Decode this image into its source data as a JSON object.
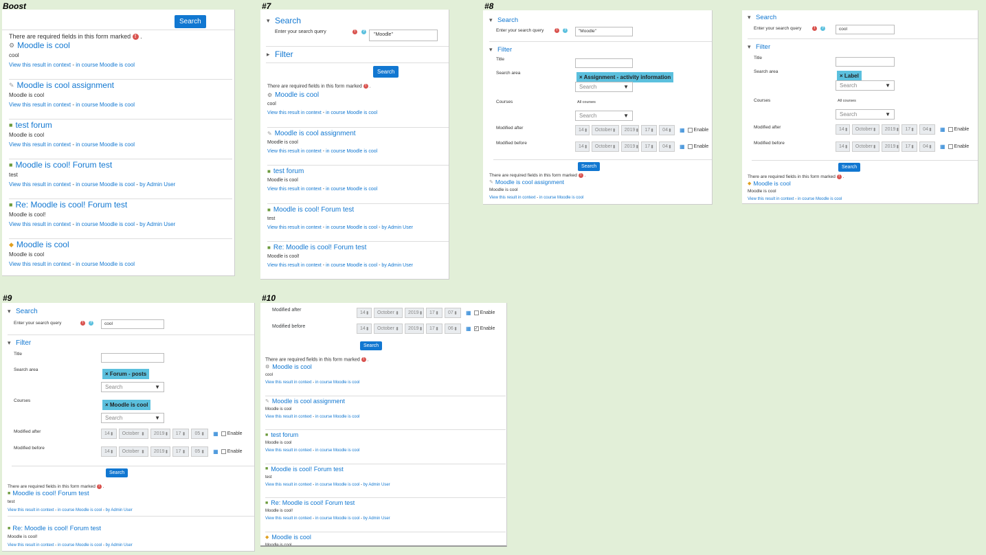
{
  "labels": {
    "boost": "Boost",
    "p7": "#7",
    "p8": "#8",
    "p9": "#9",
    "p10": "#10"
  },
  "common": {
    "search_header": "Search",
    "filter_header": "Filter",
    "query_label": "Enter your search query",
    "search_button": "Search",
    "required_note": "There are required fields in this form marked",
    "title_label": "Title",
    "area_label": "Search area",
    "courses_label": "Courses",
    "mod_after": "Modified after",
    "mod_before": "Modified before",
    "all_courses": "All courses",
    "select_placeholder": "Search",
    "enable": "Enable",
    "view_link": "View this result in context",
    "sep": " - ",
    "in_course": "in course Moodle is cool",
    "by_admin": "by Admin User",
    "date": {
      "day": "14",
      "month": "October",
      "year": "2019",
      "hour": "17"
    }
  },
  "icons": {
    "course": "course-icon",
    "assign": "assignment-icon",
    "forum": "forum-icon",
    "label": "label-icon",
    "required": "required-icon",
    "help": "help-icon",
    "calendar": "calendar-icon"
  },
  "p7": {
    "query": "\"Moodle\""
  },
  "p8": {
    "query": "\"Moodle\"",
    "area_tag": "× Assignment - activity information",
    "min_after": "04",
    "min_before": "04",
    "results": [
      {
        "title": "Moodle is cool assignment",
        "content": "Moodle is cool"
      }
    ]
  },
  "p8b": {
    "query": "cool",
    "area_tag": "× Label",
    "min_after": "04",
    "min_before": "04",
    "results": [
      {
        "title": "Moodle is cool",
        "content": "Moodle is cool"
      }
    ]
  },
  "p9": {
    "query": "cool",
    "area_tag": "× Forum - posts",
    "course_tag": "× Moodle is cool",
    "min_after": "05",
    "min_before": "05",
    "results": [
      {
        "title": "Moodle is cool! Forum test",
        "content": "test"
      },
      {
        "title": "Re: Moodle is cool! Forum test",
        "content": "Moodle is cool!"
      }
    ]
  },
  "p10": {
    "min_after": "07",
    "min_before": "06"
  },
  "results_all": [
    {
      "title": "Moodle is cool",
      "content": "cool"
    },
    {
      "title": "Moodle is cool assignment",
      "content": "Moodle is cool"
    },
    {
      "title": "test forum",
      "content": "Moodle is cool"
    },
    {
      "title": "Moodle is cool! Forum test",
      "content": "test"
    },
    {
      "title": "Re: Moodle is cool! Forum test",
      "content": "Moodle is cool!"
    },
    {
      "title": "Moodle is cool",
      "content": "Moodle is cool"
    }
  ],
  "colors": {
    "bg": "#e2efd8",
    "link": "#1177d1",
    "button": "#1177d1",
    "tag": "#5bc0de",
    "required": "#d9534f"
  }
}
